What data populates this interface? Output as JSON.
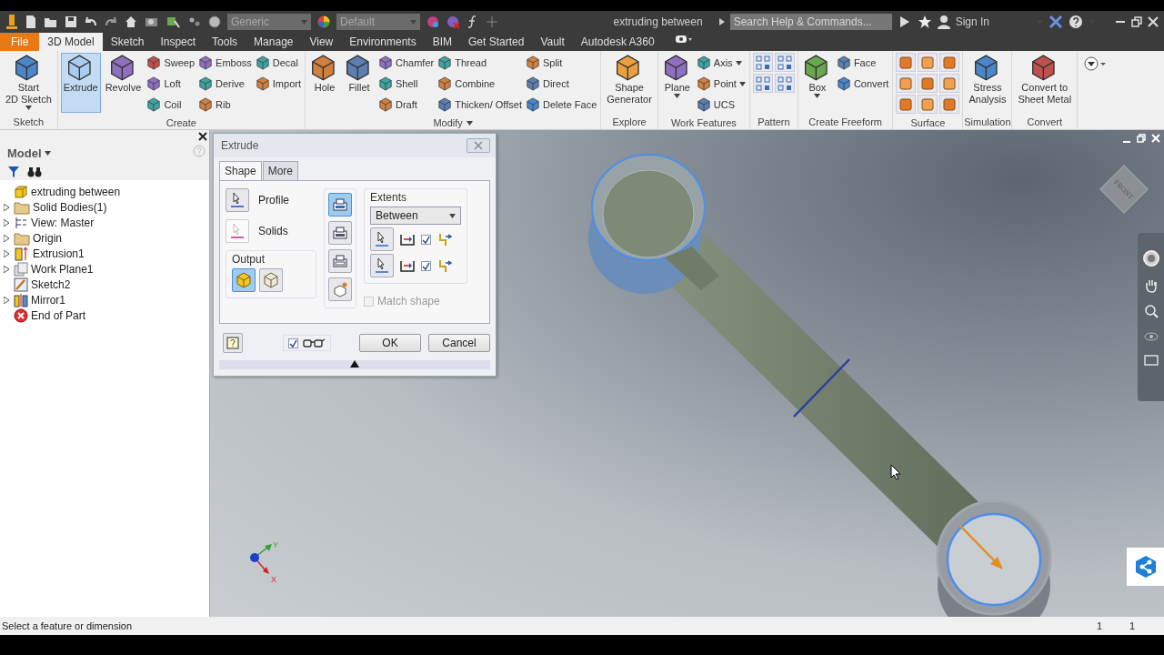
{
  "title_bar": {
    "material": "Generic",
    "appearance": "Default",
    "document": "extruding between",
    "search": {
      "placeholder": "Search Help & Commands..."
    },
    "sign_in": "Sign In"
  },
  "tabs": [
    {
      "label": "File",
      "kind": "application",
      "selected": false
    },
    {
      "label": "3D Model",
      "kind": "ribbon",
      "selected": true
    },
    {
      "label": "Sketch",
      "kind": "ribbon",
      "selected": false
    },
    {
      "label": "Inspect",
      "kind": "ribbon",
      "selected": false
    },
    {
      "label": "Tools",
      "kind": "ribbon",
      "selected": false
    },
    {
      "label": "Manage",
      "kind": "ribbon",
      "selected": false
    },
    {
      "label": "View",
      "kind": "ribbon",
      "selected": false
    },
    {
      "label": "Environments",
      "kind": "ribbon",
      "selected": false
    },
    {
      "label": "BIM",
      "kind": "ribbon",
      "selected": false
    },
    {
      "label": "Get Started",
      "kind": "ribbon",
      "selected": false
    },
    {
      "label": "Vault",
      "kind": "ribbon",
      "selected": false
    },
    {
      "label": "Autodesk A360",
      "kind": "ribbon",
      "selected": false
    }
  ],
  "ribbon": {
    "panels": [
      {
        "label": "Sketch",
        "menu": false,
        "groups": [
          {
            "kind": "large",
            "label": "Start\n2D Sketch",
            "caret": true,
            "selected": false
          }
        ]
      },
      {
        "label": "Create",
        "menu": false,
        "groups": [
          {
            "kind": "large",
            "label": "Extrude",
            "caret": false,
            "selected": true
          },
          {
            "kind": "large",
            "label": "Revolve",
            "caret": false,
            "selected": false
          },
          {
            "kind": "stack",
            "items": [
              {
                "label": "Sweep",
                "caret": false
              },
              {
                "label": "Loft",
                "caret": false
              },
              {
                "label": "Coil",
                "caret": false
              }
            ]
          },
          {
            "kind": "stack",
            "items": [
              {
                "label": "Emboss",
                "caret": false
              },
              {
                "label": "Derive",
                "caret": false
              },
              {
                "label": "Rib",
                "caret": false
              }
            ]
          },
          {
            "kind": "stack",
            "items": [
              {
                "label": "Decal",
                "caret": false
              },
              {
                "label": "Import",
                "caret": false
              }
            ]
          }
        ]
      },
      {
        "label": "Modify",
        "menu": true,
        "groups": [
          {
            "kind": "large",
            "label": "Hole",
            "caret": false,
            "selected": false
          },
          {
            "kind": "large",
            "label": "Fillet",
            "caret": false,
            "selected": false
          },
          {
            "kind": "stack",
            "items": [
              {
                "label": "Chamfer",
                "caret": false
              },
              {
                "label": "Shell",
                "caret": false
              },
              {
                "label": "Draft",
                "caret": false
              }
            ]
          },
          {
            "kind": "stack",
            "items": [
              {
                "label": "Thread",
                "caret": false
              },
              {
                "label": "Combine",
                "caret": false
              },
              {
                "label": "Thicken/ Offset",
                "caret": false
              }
            ]
          },
          {
            "kind": "stack",
            "items": [
              {
                "label": "Split",
                "caret": false
              },
              {
                "label": "Direct",
                "caret": false
              },
              {
                "label": "Delete Face",
                "caret": false
              }
            ]
          }
        ]
      },
      {
        "label": "Explore",
        "menu": false,
        "groups": [
          {
            "kind": "large",
            "label": "Shape\nGenerator",
            "caret": false,
            "selected": false
          }
        ]
      },
      {
        "label": "Work Features",
        "menu": false,
        "groups": [
          {
            "kind": "large",
            "label": "Plane",
            "caret": true,
            "selected": false
          },
          {
            "kind": "stack",
            "items": [
              {
                "label": "Axis",
                "caret": true
              },
              {
                "label": "Point",
                "caret": true
              },
              {
                "label": "UCS",
                "caret": false
              }
            ]
          }
        ]
      },
      {
        "label": "Pattern",
        "menu": false,
        "groups": [
          {
            "kind": "pattern_icons"
          }
        ]
      },
      {
        "label": "Create Freeform",
        "menu": false,
        "groups": [
          {
            "kind": "large",
            "label": "Box",
            "caret": true,
            "selected": false
          },
          {
            "kind": "stack",
            "items": [
              {
                "label": "Face",
                "caret": false
              },
              {
                "label": "Convert",
                "caret": false
              }
            ]
          }
        ]
      },
      {
        "label": "Surface",
        "menu": false,
        "groups": [
          {
            "kind": "surface_icons"
          }
        ]
      },
      {
        "label": "Simulation",
        "menu": false,
        "groups": [
          {
            "kind": "large",
            "label": "Stress\nAnalysis",
            "caret": false,
            "selected": false
          }
        ]
      },
      {
        "label": "Convert",
        "menu": false,
        "groups": [
          {
            "kind": "large",
            "label": "Convert to\nSheet Metal",
            "caret": false,
            "selected": false
          }
        ]
      }
    ]
  },
  "model_browser": {
    "title": "Model",
    "tree": [
      {
        "label": "extruding between",
        "kind": "part",
        "expandable": false,
        "children": [
          {
            "label": "Solid Bodies(1)",
            "kind": "bodies",
            "expandable": true
          },
          {
            "label": "View: Master",
            "kind": "view",
            "expandable": true
          },
          {
            "label": "Origin",
            "kind": "folder",
            "expandable": true
          },
          {
            "label": "Extrusion1",
            "kind": "extrusion",
            "expandable": true
          },
          {
            "label": "Work Plane1",
            "kind": "workplane",
            "expandable": true
          },
          {
            "label": "Sketch2",
            "kind": "sketch",
            "expandable": false
          },
          {
            "label": "Mirror1",
            "kind": "mirror",
            "expandable": true
          },
          {
            "label": "End of Part",
            "kind": "end",
            "expandable": false
          }
        ]
      }
    ]
  },
  "dialog": {
    "title": "Extrude",
    "tabs": [
      {
        "label": "Shape",
        "selected": true
      },
      {
        "label": "More",
        "selected": false
      }
    ],
    "selectors": [
      {
        "label": "Profile",
        "kind": "profile"
      },
      {
        "label": "Solids",
        "kind": "solids"
      }
    ],
    "output": {
      "label": "Output",
      "options": [
        {
          "kind": "solid",
          "selected": true
        },
        {
          "kind": "surface",
          "selected": false
        }
      ]
    },
    "operations": [
      {
        "kind": "join",
        "selected": true
      },
      {
        "kind": "cut",
        "selected": false
      },
      {
        "kind": "intersect",
        "selected": false
      },
      {
        "kind": "new_solid",
        "selected": false
      }
    ],
    "extents": {
      "label": "Extents",
      "value": "Between",
      "terminations": [
        {
          "checked": true
        },
        {
          "checked": true
        }
      ]
    },
    "match_shape": {
      "label": "Match shape",
      "checked": false,
      "disabled": true
    },
    "preview": {
      "checked": true
    },
    "buttons": [
      "OK",
      "Cancel"
    ]
  },
  "viewport": {
    "view_cube": "FRONT",
    "triad": {
      "x": "X",
      "y": "Y"
    }
  },
  "status_bar": {
    "prompt": "Select a feature or dimension",
    "fields": [
      "1",
      "1"
    ]
  }
}
